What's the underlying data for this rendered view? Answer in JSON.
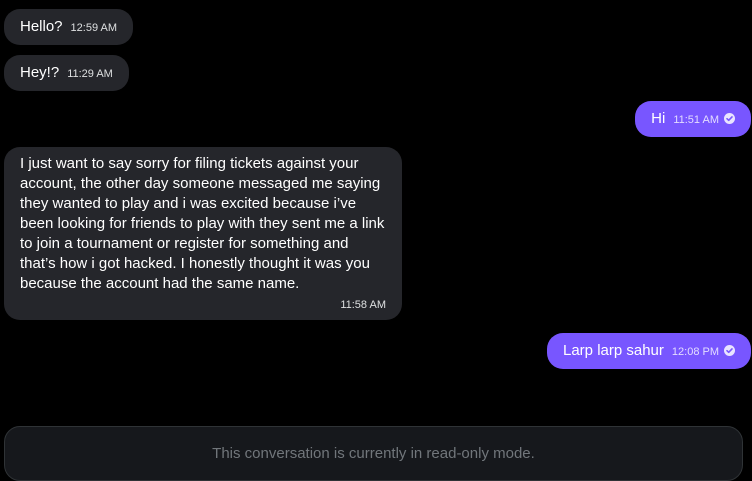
{
  "messages": [
    {
      "direction": "incoming",
      "text": "Hello?",
      "time": "12:59 AM"
    },
    {
      "direction": "incoming",
      "text": "Hey!?",
      "time": "11:29 AM"
    },
    {
      "direction": "outgoing",
      "text": "Hi",
      "time": "11:51 AM",
      "status": "sent"
    },
    {
      "direction": "incoming",
      "text": "I just want to say sorry for filing tickets against your account, the other day someone messaged me saying they wanted to play and i was excited because i’ve been looking for friends to play with they sent me a link to join a tournament or register for something and that’s how i got hacked. I honestly thought it was you because the account had the same name.",
      "time": "11:58 AM"
    },
    {
      "direction": "outgoing",
      "text": "Larp larp sahur",
      "time": "12:08 PM",
      "status": "sent"
    }
  ],
  "composer": {
    "readonly_notice": "This conversation is currently in read-only mode."
  },
  "colors": {
    "background": "#000000",
    "incoming_bubble": "#25262b",
    "outgoing_bubble": "#7856ff",
    "muted_text": "#71767b"
  }
}
